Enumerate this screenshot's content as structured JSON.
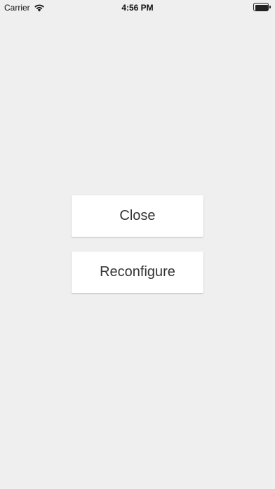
{
  "status_bar": {
    "carrier": "Carrier",
    "time": "4:56 PM",
    "wifi_icon": "wifi-icon",
    "battery_icon": "battery-icon"
  },
  "actions": {
    "close_label": "Close",
    "reconfigure_label": "Reconfigure"
  },
  "colors": {
    "background": "#efefef",
    "button_background": "#ffffff",
    "button_text": "#333333"
  }
}
